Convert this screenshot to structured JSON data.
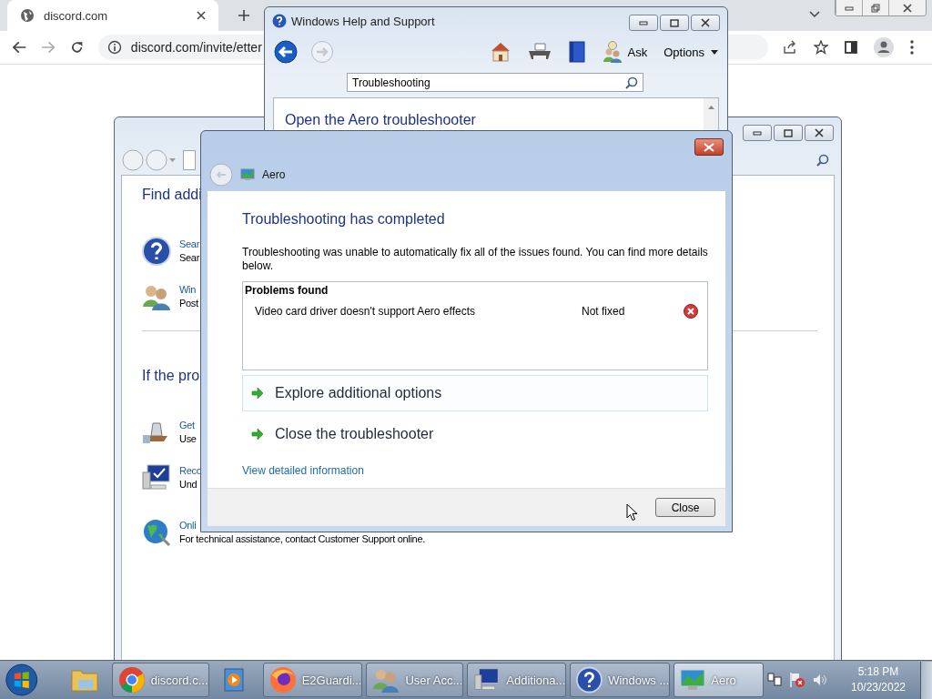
{
  "browser": {
    "tab": {
      "title": "discord.com",
      "selected": true
    },
    "address": "discord.com/invite/etter"
  },
  "help_window": {
    "title": "Windows Help and Support",
    "ask": "Ask",
    "options": "Options",
    "search": {
      "value": "Troubleshooting"
    },
    "topic_link": "Open the Aero troubleshooter"
  },
  "back_window": {
    "sections": [
      {
        "heading": "Find addi",
        "items": [
          {
            "link": "Sear",
            "description": "Sear"
          },
          {
            "link": "Win",
            "description": "Post"
          }
        ]
      },
      {
        "heading": "If the pro",
        "items": [
          {
            "link": "Get",
            "description": "Use"
          },
          {
            "link": "Reco",
            "description": "Und"
          },
          {
            "link": "Onli",
            "description": "For technical assistance, contact Customer Support online."
          }
        ]
      }
    ]
  },
  "dialog": {
    "title": "Aero",
    "heading": "Troubleshooting has completed",
    "message": "Troubleshooting was unable to automatically fix all of the issues found. You can find more details below.",
    "problems": {
      "title": "Problems found",
      "rows": [
        {
          "problem": "Video card driver doesn't support Aero effects",
          "status": "Not fixed",
          "fixed": false
        }
      ]
    },
    "options": [
      {
        "label": "Explore additional options",
        "selected": true
      },
      {
        "label": "Close the troubleshooter",
        "selected": false
      }
    ],
    "details_link": "View detailed information",
    "close_button": "Close"
  },
  "taskbar": {
    "items": [
      {
        "kind": "pinned",
        "selected": false
      },
      {
        "kind": "window",
        "label": "discord.c...",
        "selected": false
      },
      {
        "kind": "pinned",
        "selected": false
      },
      {
        "kind": "window",
        "label": "E2Guardi...",
        "selected": false
      },
      {
        "kind": "window",
        "label": "User Acc...",
        "selected": false
      },
      {
        "kind": "window",
        "label": "Additiona...",
        "selected": false
      },
      {
        "kind": "window",
        "label": "Windows ...",
        "selected": false
      },
      {
        "kind": "window",
        "label": "Aero",
        "selected": true
      }
    ],
    "time": "5:18 PM",
    "date": "10/23/2022"
  }
}
